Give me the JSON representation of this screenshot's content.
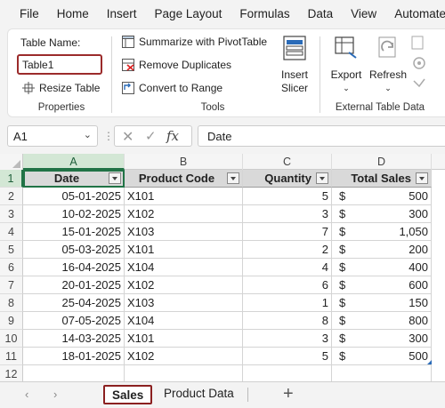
{
  "menu": [
    "File",
    "Home",
    "Insert",
    "Page Layout",
    "Formulas",
    "Data",
    "View",
    "Automate"
  ],
  "ribbon": {
    "properties": {
      "table_name_label": "Table Name:",
      "table_name_value": "Table1",
      "resize_label": "Resize Table",
      "group_label": "Properties"
    },
    "tools": {
      "summarize_label": "Summarize with PivotTable",
      "remove_dupes_label": "Remove Duplicates",
      "convert_label": "Convert to Range",
      "group_label": "Tools"
    },
    "slicer": {
      "line1": "Insert",
      "line2": "Slicer"
    },
    "external": {
      "export_label": "Export",
      "refresh_label": "Refresh",
      "group_label": "External Table Data"
    }
  },
  "formula_bar": {
    "name_box": "A1",
    "formula": "Date"
  },
  "grid": {
    "columns": [
      "A",
      "B",
      "C",
      "D"
    ],
    "row_numbers": [
      "1",
      "2",
      "3",
      "4",
      "5",
      "6",
      "7",
      "8",
      "9",
      "10",
      "11",
      "12"
    ],
    "headers": [
      "Date",
      "Product Code",
      "Quantity",
      "Total Sales"
    ],
    "currency_symbol": "$",
    "rows": [
      {
        "date": "05-01-2025",
        "code": "X101",
        "qty": "5",
        "sales": "500"
      },
      {
        "date": "10-02-2025",
        "code": "X102",
        "qty": "3",
        "sales": "300"
      },
      {
        "date": "15-01-2025",
        "code": "X103",
        "qty": "7",
        "sales": "1,050"
      },
      {
        "date": "05-03-2025",
        "code": "X101",
        "qty": "2",
        "sales": "200"
      },
      {
        "date": "16-04-2025",
        "code": "X104",
        "qty": "4",
        "sales": "400"
      },
      {
        "date": "20-01-2025",
        "code": "X102",
        "qty": "6",
        "sales": "600"
      },
      {
        "date": "25-04-2025",
        "code": "X103",
        "qty": "1",
        "sales": "150"
      },
      {
        "date": "07-05-2025",
        "code": "X104",
        "qty": "8",
        "sales": "800"
      },
      {
        "date": "14-03-2025",
        "code": "X101",
        "qty": "3",
        "sales": "300"
      },
      {
        "date": "18-01-2025",
        "code": "X102",
        "qty": "5",
        "sales": "500"
      }
    ]
  },
  "sheets": {
    "tabs": [
      "Sales",
      "Product Data"
    ],
    "active": "Sales",
    "add_symbol": "+"
  },
  "colors": {
    "accent_green": "#217346",
    "table_header_fill": "#d9d9d9",
    "highlight_border": "#8b2020"
  }
}
